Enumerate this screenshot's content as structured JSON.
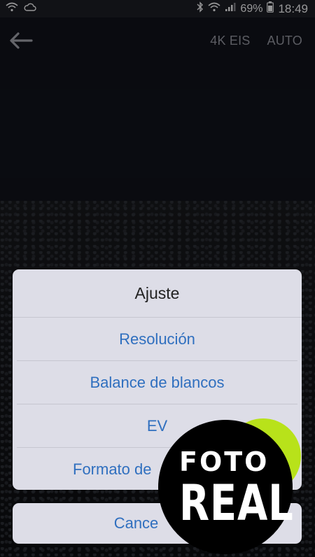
{
  "status_bar": {
    "battery": "69%",
    "time": "18:49"
  },
  "toolbar": {
    "options": [
      "4K EIS",
      "AUTO"
    ]
  },
  "dialog": {
    "title": "Ajuste",
    "options": [
      "Resolución",
      "Balance de blancos",
      "EV",
      "Formato de"
    ]
  },
  "cancel_label": "Cance",
  "badge": {
    "line1": "FOTO",
    "line2": "REAL"
  },
  "colors": {
    "accent": "#2f6fbf",
    "badge_green": "#b8e21a",
    "dialog_bg": "#dddde7"
  }
}
